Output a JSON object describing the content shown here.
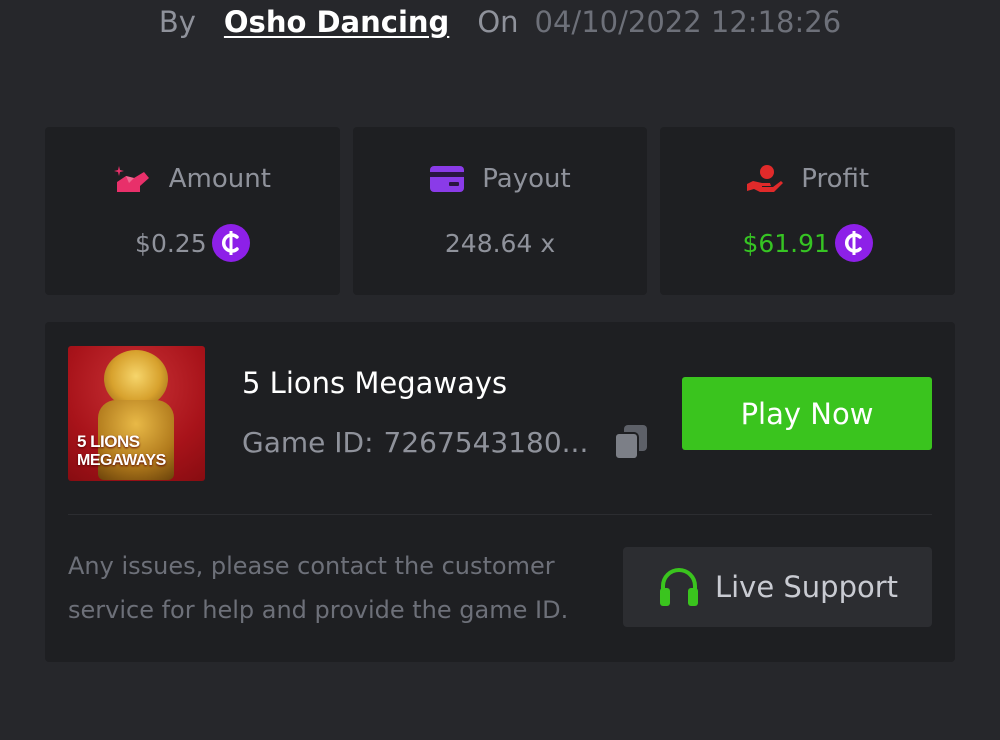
{
  "byline": {
    "by": "By",
    "user": "Osho Dancing",
    "on": "On",
    "date": "04/10/2022 12:18:26"
  },
  "stats": {
    "amount": {
      "label": "Amount",
      "value": "$0.25",
      "icon": "amount-icon"
    },
    "payout": {
      "label": "Payout",
      "value": "248.64 x",
      "icon": "card-icon"
    },
    "profit": {
      "label": "Profit",
      "value": "$61.91",
      "icon": "hand-profit-icon"
    }
  },
  "game": {
    "name": "5 Lions Megaways",
    "thumb_title_1": "5 LIONS",
    "thumb_title_2": "MEGAWAYS",
    "id_label": "Game ID:",
    "id_value": "7267543180...",
    "play_label": "Play Now"
  },
  "support": {
    "help_text": "Any issues, please contact the customer service for help and provide the game ID.",
    "button_label": "Live Support"
  },
  "colors": {
    "background": "#26272b",
    "card": "#1e1f22",
    "play_button": "#3ac41e",
    "profit_text": "#36c423",
    "coin": "#8d20e8",
    "amount_icon": "#e8306a",
    "payout_icon": "#8a3be8",
    "profit_icon": "#e02a2a",
    "support_icon": "#3ac41e"
  }
}
